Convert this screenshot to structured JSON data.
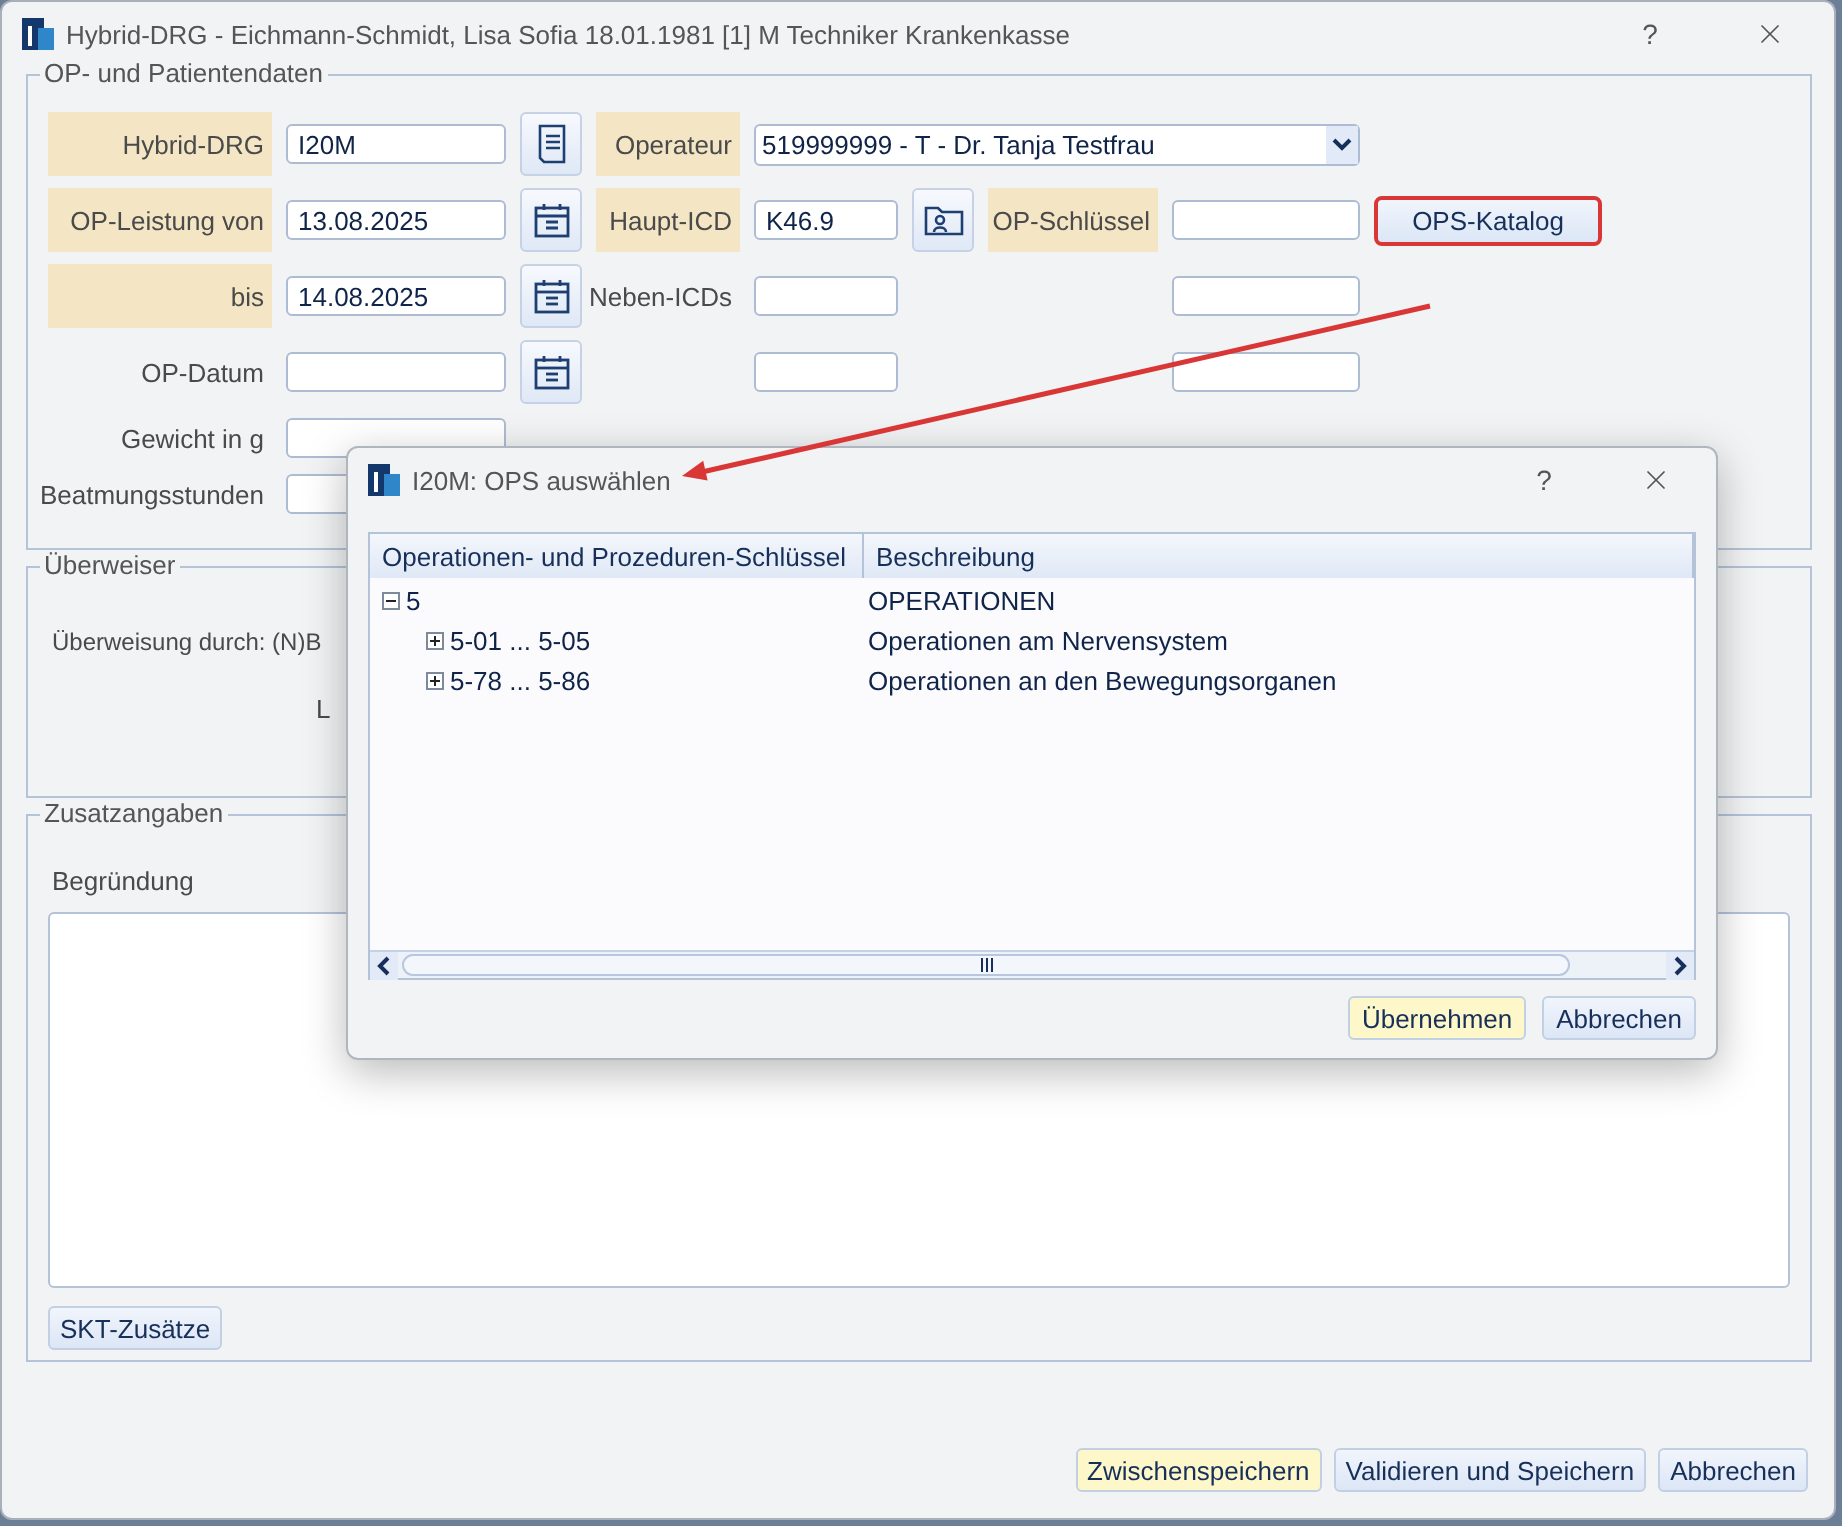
{
  "window": {
    "title": "Hybrid-DRG - Eichmann-Schmidt, Lisa Sofia 18.01.1981 [1] M Techniker Krankenkasse",
    "help": "?"
  },
  "op_section": {
    "legend": "OP- und Patientendaten",
    "hybrid_drg": {
      "label": "Hybrid-DRG",
      "required": true,
      "value": "I20M"
    },
    "operateur": {
      "label": "Operateur",
      "required": true,
      "value": "519999999 - T - Dr. Tanja Testfrau"
    },
    "op_leistung_von": {
      "label": "OP-Leistung von",
      "required": true,
      "value": "13.08.2025"
    },
    "haupt_icd": {
      "label": "Haupt-ICD",
      "required": true,
      "value": "K46.9"
    },
    "op_schluessel": {
      "label": "OP-Schlüssel",
      "required": true
    },
    "ops_katalog": {
      "label": "OPS-Katalog",
      "highlighted": true
    },
    "bis": {
      "label": "bis",
      "required": true,
      "value": "14.08.2025"
    },
    "neben_icds": {
      "label": "Neben-ICDs",
      "required": false
    },
    "op_datum": {
      "label": "OP-Datum",
      "required": false
    },
    "gewicht": {
      "label": "Gewicht in g",
      "required": false
    },
    "beatmungsstunden": {
      "label": "Beatmungsstunden",
      "required": false
    }
  },
  "referrer_section": {
    "legend": "Überweiser",
    "referral_text": "Überweisung durch: (N)B",
    "second_text": "L"
  },
  "extra_section": {
    "legend": "Zusatzangaben",
    "reason_label": "Begründung",
    "skt_button": "SKT-Zusätze"
  },
  "footer_buttons": [
    {
      "label": "Zwischenspeichern",
      "default": true
    },
    {
      "label": "Validieren und Speichern",
      "default": false
    },
    {
      "label": "Abbrechen",
      "default": false
    }
  ],
  "dialog": {
    "title": "I20M: OPS auswählen",
    "help": "?",
    "columns": [
      "Operationen- und Prozeduren-Schlüssel",
      "Beschreibung"
    ],
    "tree": [
      {
        "code": "5",
        "description": "OPERATIONEN",
        "expanded": true,
        "children": [
          {
            "code": "5-01 ... 5-05",
            "description": "Operationen am Nervensystem",
            "expanded": false
          },
          {
            "code": "5-78 ... 5-86",
            "description": "Operationen an den Bewegungsorganen",
            "expanded": false
          }
        ]
      }
    ],
    "buttons": [
      {
        "label": "Übernehmen",
        "default": true
      },
      {
        "label": "Abbrechen",
        "default": false
      }
    ]
  }
}
